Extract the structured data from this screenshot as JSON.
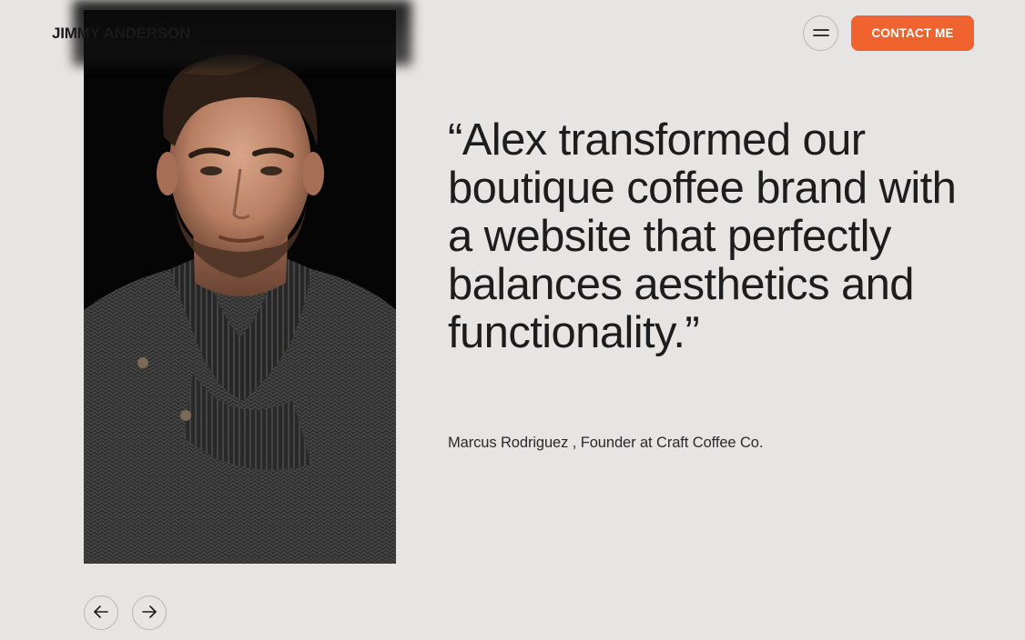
{
  "header": {
    "logo": "JIMMY ANDERSON",
    "menu_icon": "menu-equals-icon",
    "contact_label": "CONTACT ME"
  },
  "testimonial": {
    "quote": "“Alex transformed our boutique coffee brand with a website that perfectly balances aesthetics and functionality.”",
    "attribution": "Marcus Rodriguez , Founder at Craft Coffee Co.",
    "portrait": "portrait-photo"
  },
  "carousel": {
    "prev_icon": "arrow-left-icon",
    "next_icon": "arrow-right-icon"
  },
  "colors": {
    "background": "#e6e5e3",
    "accent": "#f0632f",
    "text": "#1d1d1d"
  }
}
